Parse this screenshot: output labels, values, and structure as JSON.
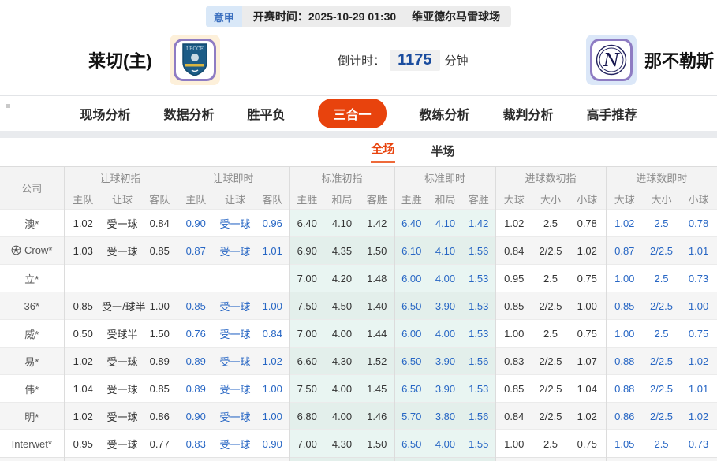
{
  "top_bar": {
    "league": "意甲",
    "start_time_label": "开赛时间：",
    "start_time": "2025-10-29 01:30",
    "venue": "维亚德尔马雷球场"
  },
  "match": {
    "home_team": "莱切(主)",
    "away_team": "那不勒斯",
    "countdown_label": "倒计时：",
    "countdown_value": "1175",
    "countdown_unit": "分钟"
  },
  "nav_tabs": [
    {
      "label": "现场分析",
      "active": false
    },
    {
      "label": "数据分析",
      "active": false
    },
    {
      "label": "胜平负",
      "active": false
    },
    {
      "label": "三合一",
      "active": true
    },
    {
      "label": "教练分析",
      "active": false
    },
    {
      "label": "裁判分析",
      "active": false
    },
    {
      "label": "高手推荐",
      "active": false
    }
  ],
  "sub_tabs": [
    {
      "label": "全场",
      "active": true
    },
    {
      "label": "半场",
      "active": false
    }
  ],
  "colors": {
    "accent": "#e8430d",
    "live_text": "#2766c4",
    "league_text": "#3a6fbf",
    "league_bg": "#d9e8f8",
    "countdown_text": "#1a4c9e",
    "tint_bg": "#e9f5f2"
  },
  "table": {
    "company_header": "公司",
    "groups": [
      {
        "label": "让球初指",
        "cols": [
          "主队",
          "让球",
          "客队"
        ],
        "live": false,
        "tint": false
      },
      {
        "label": "让球即时",
        "cols": [
          "主队",
          "让球",
          "客队"
        ],
        "live": true,
        "tint": false
      },
      {
        "label": "标准初指",
        "cols": [
          "主胜",
          "和局",
          "客胜"
        ],
        "live": false,
        "tint": true
      },
      {
        "label": "标准即时",
        "cols": [
          "主胜",
          "和局",
          "客胜"
        ],
        "live": true,
        "tint": true
      },
      {
        "label": "进球数初指",
        "cols": [
          "大球",
          "大小",
          "小球"
        ],
        "live": false,
        "tint": false
      },
      {
        "label": "进球数即时",
        "cols": [
          "大球",
          "大小",
          "小球"
        ],
        "live": true,
        "tint": false
      }
    ],
    "rows": [
      {
        "company": "澳*",
        "icon": null,
        "cells": [
          [
            "1.02",
            "受一球",
            "0.84"
          ],
          [
            "0.90",
            "受一球",
            "0.96"
          ],
          [
            "6.40",
            "4.10",
            "1.42"
          ],
          [
            "6.40",
            "4.10",
            "1.42"
          ],
          [
            "1.02",
            "2.5",
            "0.78"
          ],
          [
            "1.02",
            "2.5",
            "0.78"
          ]
        ]
      },
      {
        "company": "Crow*",
        "icon": "soccer-ball-icon",
        "cells": [
          [
            "1.03",
            "受一球",
            "0.85"
          ],
          [
            "0.87",
            "受一球",
            "1.01"
          ],
          [
            "6.90",
            "4.35",
            "1.50"
          ],
          [
            "6.10",
            "4.10",
            "1.56"
          ],
          [
            "0.84",
            "2/2.5",
            "1.02"
          ],
          [
            "0.87",
            "2/2.5",
            "1.01"
          ]
        ]
      },
      {
        "company": "立*",
        "icon": null,
        "cells": [
          [
            "",
            "",
            ""
          ],
          [
            "",
            "",
            ""
          ],
          [
            "7.00",
            "4.20",
            "1.48"
          ],
          [
            "6.00",
            "4.00",
            "1.53"
          ],
          [
            "0.95",
            "2.5",
            "0.75"
          ],
          [
            "1.00",
            "2.5",
            "0.73"
          ]
        ]
      },
      {
        "company": "36*",
        "icon": null,
        "cells": [
          [
            "0.85",
            "受一/球半",
            "1.00"
          ],
          [
            "0.85",
            "受一球",
            "1.00"
          ],
          [
            "7.50",
            "4.50",
            "1.40"
          ],
          [
            "6.50",
            "3.90",
            "1.53"
          ],
          [
            "0.85",
            "2/2.5",
            "1.00"
          ],
          [
            "0.85",
            "2/2.5",
            "1.00"
          ]
        ]
      },
      {
        "company": "威*",
        "icon": null,
        "cells": [
          [
            "0.50",
            "受球半",
            "1.50"
          ],
          [
            "0.76",
            "受一球",
            "0.84"
          ],
          [
            "7.00",
            "4.00",
            "1.44"
          ],
          [
            "6.00",
            "4.00",
            "1.53"
          ],
          [
            "1.00",
            "2.5",
            "0.75"
          ],
          [
            "1.00",
            "2.5",
            "0.75"
          ]
        ]
      },
      {
        "company": "易*",
        "icon": null,
        "cells": [
          [
            "1.02",
            "受一球",
            "0.89"
          ],
          [
            "0.89",
            "受一球",
            "1.02"
          ],
          [
            "6.60",
            "4.30",
            "1.52"
          ],
          [
            "6.50",
            "3.90",
            "1.56"
          ],
          [
            "0.83",
            "2/2.5",
            "1.07"
          ],
          [
            "0.88",
            "2/2.5",
            "1.02"
          ]
        ]
      },
      {
        "company": "伟*",
        "icon": null,
        "cells": [
          [
            "1.04",
            "受一球",
            "0.85"
          ],
          [
            "0.89",
            "受一球",
            "1.00"
          ],
          [
            "7.50",
            "4.00",
            "1.45"
          ],
          [
            "6.50",
            "3.90",
            "1.53"
          ],
          [
            "0.85",
            "2/2.5",
            "1.04"
          ],
          [
            "0.88",
            "2/2.5",
            "1.01"
          ]
        ]
      },
      {
        "company": "明*",
        "icon": null,
        "cells": [
          [
            "1.02",
            "受一球",
            "0.86"
          ],
          [
            "0.90",
            "受一球",
            "1.00"
          ],
          [
            "6.80",
            "4.00",
            "1.46"
          ],
          [
            "5.70",
            "3.80",
            "1.56"
          ],
          [
            "0.84",
            "2/2.5",
            "1.02"
          ],
          [
            "0.86",
            "2/2.5",
            "1.02"
          ]
        ]
      },
      {
        "company": "Interwet*",
        "icon": null,
        "cells": [
          [
            "0.95",
            "受一球",
            "0.77"
          ],
          [
            "0.83",
            "受一球",
            "0.90"
          ],
          [
            "7.00",
            "4.30",
            "1.50"
          ],
          [
            "6.50",
            "4.00",
            "1.55"
          ],
          [
            "1.00",
            "2.5",
            "0.75"
          ],
          [
            "1.05",
            "2.5",
            "0.73"
          ]
        ]
      }
    ]
  }
}
